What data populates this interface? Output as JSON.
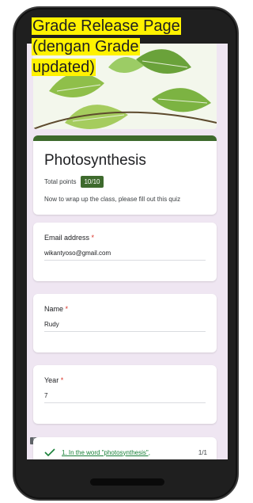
{
  "caption": {
    "line1": "Grade Release Page",
    "line2": "(dengan Grade",
    "line3": "updated)"
  },
  "form": {
    "title": "Photosynthesis",
    "total_points_label": "Total points",
    "score": "10/10",
    "description": "Now to wrap up the class, please fill out this quiz",
    "accent_color": "#3e6a2d"
  },
  "fields": {
    "email": {
      "label": "Email address",
      "value": "wikantyoso@gmail.com"
    },
    "name": {
      "label": "Name",
      "value": "Rudy"
    },
    "year": {
      "label": "Year",
      "value": "7"
    },
    "required_mark": "*"
  },
  "question": {
    "text": "1. In the word \"photosynthesis\",",
    "score": "1/1",
    "status_icon": "check-icon",
    "feedback_icon": "comment-icon",
    "feedback_glyph": "!"
  }
}
